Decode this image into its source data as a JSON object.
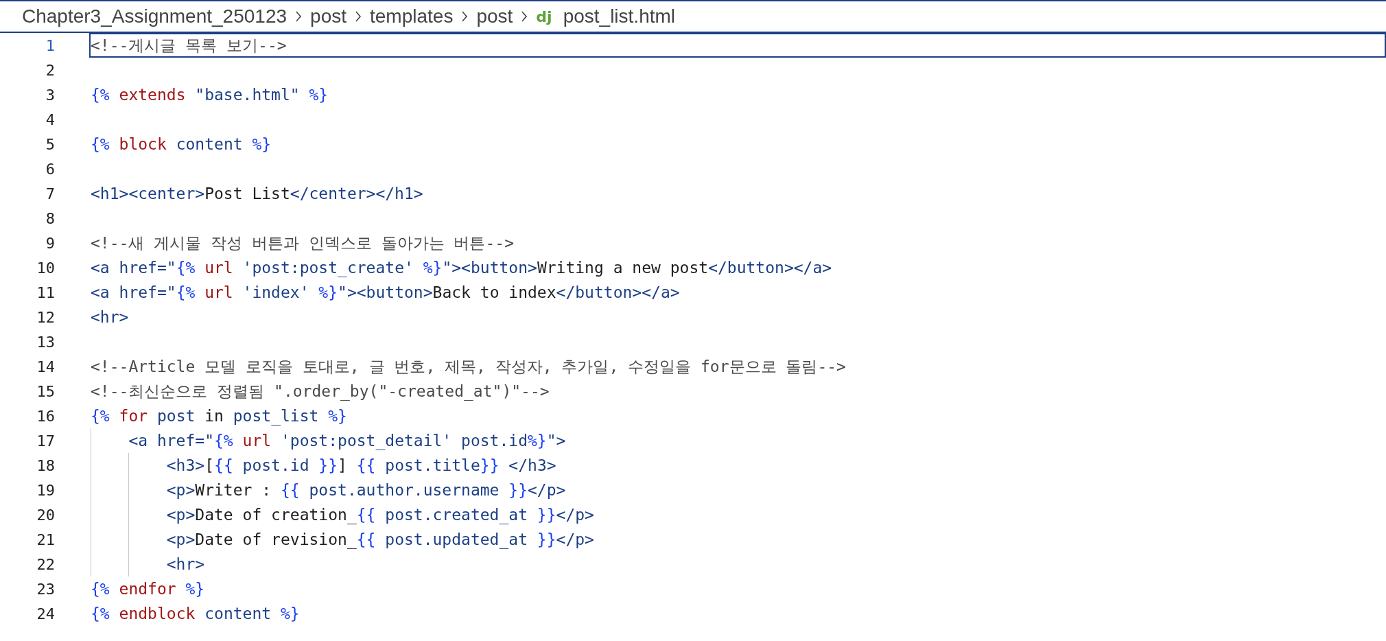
{
  "breadcrumb": {
    "folders": [
      "Chapter3_Assignment_250123",
      "post",
      "templates",
      "post"
    ],
    "file": {
      "icon_text": "dj",
      "name": "post_list.html"
    }
  },
  "lines": [
    {
      "number": "1",
      "current": true,
      "tokens": [
        {
          "kind": "comment",
          "text": "<!--게시글 목록 보기-->"
        }
      ]
    },
    {
      "number": "2",
      "current": false
    },
    {
      "number": "3",
      "current": false,
      "tokens": [
        {
          "kind": "delim",
          "text": "{%"
        },
        {
          "kind": "keyword",
          "text": " extends "
        },
        {
          "kind": "tag",
          "text": "\"base.html\" "
        },
        {
          "kind": "delim",
          "text": "%}"
        }
      ]
    },
    {
      "number": "4",
      "current": false
    },
    {
      "number": "5",
      "current": false,
      "tokens": [
        {
          "kind": "delim",
          "text": "{%"
        },
        {
          "kind": "keyword",
          "text": " block "
        },
        {
          "kind": "tag",
          "text": "content "
        },
        {
          "kind": "delim",
          "text": "%}"
        }
      ]
    },
    {
      "number": "6",
      "current": false
    },
    {
      "number": "7",
      "current": false,
      "tokens": [
        {
          "kind": "tag",
          "text": "<h1><center>"
        },
        {
          "kind": "plain",
          "text": "Post List"
        },
        {
          "kind": "tag",
          "text": "</center></h1>"
        }
      ]
    },
    {
      "number": "8",
      "current": false
    },
    {
      "number": "9",
      "current": false,
      "tokens": [
        {
          "kind": "comment",
          "text": "<!--새 게시물 작성 버튼과 인덱스로 돌아가는 버튼-->"
        }
      ]
    },
    {
      "number": "10",
      "current": false,
      "tokens": [
        {
          "kind": "tag",
          "text": "<a href=\""
        },
        {
          "kind": "delim",
          "text": "{%"
        },
        {
          "kind": "keyword",
          "text": " url "
        },
        {
          "kind": "tag",
          "text": "'post:post_create' "
        },
        {
          "kind": "delim",
          "text": "%}"
        },
        {
          "kind": "tag",
          "text": "\"><button>"
        },
        {
          "kind": "plain",
          "text": "Writing a new post"
        },
        {
          "kind": "tag",
          "text": "</button></a>"
        }
      ]
    },
    {
      "number": "11",
      "current": false,
      "tokens": [
        {
          "kind": "tag",
          "text": "<a href=\""
        },
        {
          "kind": "delim",
          "text": "{%"
        },
        {
          "kind": "keyword",
          "text": " url "
        },
        {
          "kind": "tag",
          "text": "'index' "
        },
        {
          "kind": "delim",
          "text": "%}"
        },
        {
          "kind": "tag",
          "text": "\"><button>"
        },
        {
          "kind": "plain",
          "text": "Back to index"
        },
        {
          "kind": "tag",
          "text": "</button></a>"
        }
      ]
    },
    {
      "number": "12",
      "current": false,
      "tokens": [
        {
          "kind": "tag",
          "text": "<hr>"
        }
      ]
    },
    {
      "number": "13",
      "current": false
    },
    {
      "number": "14",
      "current": false,
      "tokens": [
        {
          "kind": "comment",
          "text": "<!--Article 모델 로직을 토대로, 글 번호, 제목, 작성자, 추가일, 수정일을 for문으로 돌림-->"
        }
      ]
    },
    {
      "number": "15",
      "current": false,
      "tokens": [
        {
          "kind": "comment",
          "text": "<!--최신순으로 정렬됨 \".order_by(\"-created_at\")\"-->"
        }
      ]
    },
    {
      "number": "16",
      "current": false,
      "tokens": [
        {
          "kind": "delim",
          "text": "{%"
        },
        {
          "kind": "keyword",
          "text": " for "
        },
        {
          "kind": "tag",
          "text": "post "
        },
        {
          "kind": "plain",
          "text": "in "
        },
        {
          "kind": "tag",
          "text": "post_list "
        },
        {
          "kind": "delim",
          "text": "%}"
        }
      ]
    },
    {
      "number": "17",
      "current": false,
      "tokens": [
        {
          "kind": "tag",
          "text": "    <a href=\""
        },
        {
          "kind": "delim",
          "text": "{%"
        },
        {
          "kind": "keyword",
          "text": " url "
        },
        {
          "kind": "tag",
          "text": "'post:post_detail' post.id"
        },
        {
          "kind": "delim",
          "text": "%}"
        },
        {
          "kind": "tag",
          "text": "\">"
        }
      ]
    },
    {
      "number": "18",
      "current": false,
      "tokens": [
        {
          "kind": "tag",
          "text": "        <h3>"
        },
        {
          "kind": "plain",
          "text": "["
        },
        {
          "kind": "delim",
          "text": "{{"
        },
        {
          "kind": "tag",
          "text": " post.id "
        },
        {
          "kind": "delim",
          "text": "}}"
        },
        {
          "kind": "plain",
          "text": "] "
        },
        {
          "kind": "delim",
          "text": "{{"
        },
        {
          "kind": "tag",
          "text": " post.title"
        },
        {
          "kind": "delim",
          "text": "}}"
        },
        {
          "kind": "tag",
          "text": " </h3>"
        }
      ]
    },
    {
      "number": "19",
      "current": false,
      "tokens": [
        {
          "kind": "tag",
          "text": "        <p>"
        },
        {
          "kind": "plain",
          "text": "Writer : "
        },
        {
          "kind": "delim",
          "text": "{{"
        },
        {
          "kind": "tag",
          "text": " post.author.username "
        },
        {
          "kind": "delim",
          "text": "}}"
        },
        {
          "kind": "tag",
          "text": "</p>"
        }
      ]
    },
    {
      "number": "20",
      "current": false,
      "tokens": [
        {
          "kind": "tag",
          "text": "        <p>"
        },
        {
          "kind": "plain",
          "text": "Date of creation_"
        },
        {
          "kind": "delim",
          "text": "{{"
        },
        {
          "kind": "tag",
          "text": " post.created_at "
        },
        {
          "kind": "delim",
          "text": "}}"
        },
        {
          "kind": "tag",
          "text": "</p>"
        }
      ]
    },
    {
      "number": "21",
      "current": false,
      "tokens": [
        {
          "kind": "tag",
          "text": "        <p>"
        },
        {
          "kind": "plain",
          "text": "Date of revision_"
        },
        {
          "kind": "delim",
          "text": "{{"
        },
        {
          "kind": "tag",
          "text": " post.updated_at "
        },
        {
          "kind": "delim",
          "text": "}}"
        },
        {
          "kind": "tag",
          "text": "</p>"
        }
      ]
    },
    {
      "number": "22",
      "current": false,
      "tokens": [
        {
          "kind": "tag",
          "text": "        <hr>"
        }
      ]
    },
    {
      "number": "23",
      "current": false,
      "tokens": [
        {
          "kind": "delim",
          "text": "{%"
        },
        {
          "kind": "keyword",
          "text": " endfor "
        },
        {
          "kind": "delim",
          "text": "%}"
        }
      ]
    },
    {
      "number": "24",
      "current": false,
      "tokens": [
        {
          "kind": "delim",
          "text": "{%"
        },
        {
          "kind": "keyword",
          "text": " endblock "
        },
        {
          "kind": "tag",
          "text": "content "
        },
        {
          "kind": "delim",
          "text": "%}"
        }
      ]
    }
  ]
}
